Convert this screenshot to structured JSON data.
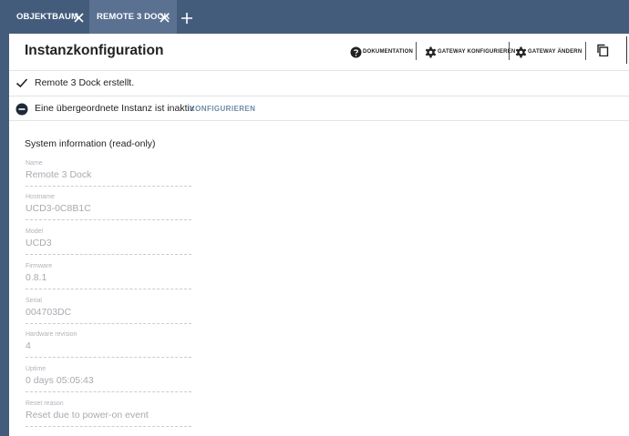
{
  "tabs": [
    {
      "label": "OBJEKTBAUM",
      "active": false
    },
    {
      "label": "REMOTE 3 DOCK",
      "active": true
    }
  ],
  "header": {
    "title": "Instanzkonfiguration",
    "buttons": {
      "documentation": "DOKUMENTATION",
      "gateway_configure": "GATEWAY KONFIGURIEREN",
      "gateway_change": "GATEWAY ÄNDERN"
    }
  },
  "messages": {
    "created": "Remote 3 Dock erstellt.",
    "inactive": "Eine übergeordnete Instanz ist inaktiv",
    "inactive_action": "KONFIGURIEREN"
  },
  "system_info": {
    "title": "System information (read-only)",
    "fields": [
      {
        "label": "Name",
        "value": "Remote 3 Dock"
      },
      {
        "label": "Hostname",
        "value": "UCD3-0C8B1C"
      },
      {
        "label": "Model",
        "value": "UCD3"
      },
      {
        "label": "Firmware",
        "value": "0.8.1"
      },
      {
        "label": "Serial",
        "value": "004703DC"
      },
      {
        "label": "Hardware revision",
        "value": "4"
      },
      {
        "label": "Uptime",
        "value": "0 days 05:05:43"
      },
      {
        "label": "Reset reason",
        "value": "Reset due to power-on event"
      }
    ]
  },
  "colors": {
    "tabbar": "#445c7c",
    "active_tab": "#5a7191",
    "link": "#6e8ba8"
  }
}
